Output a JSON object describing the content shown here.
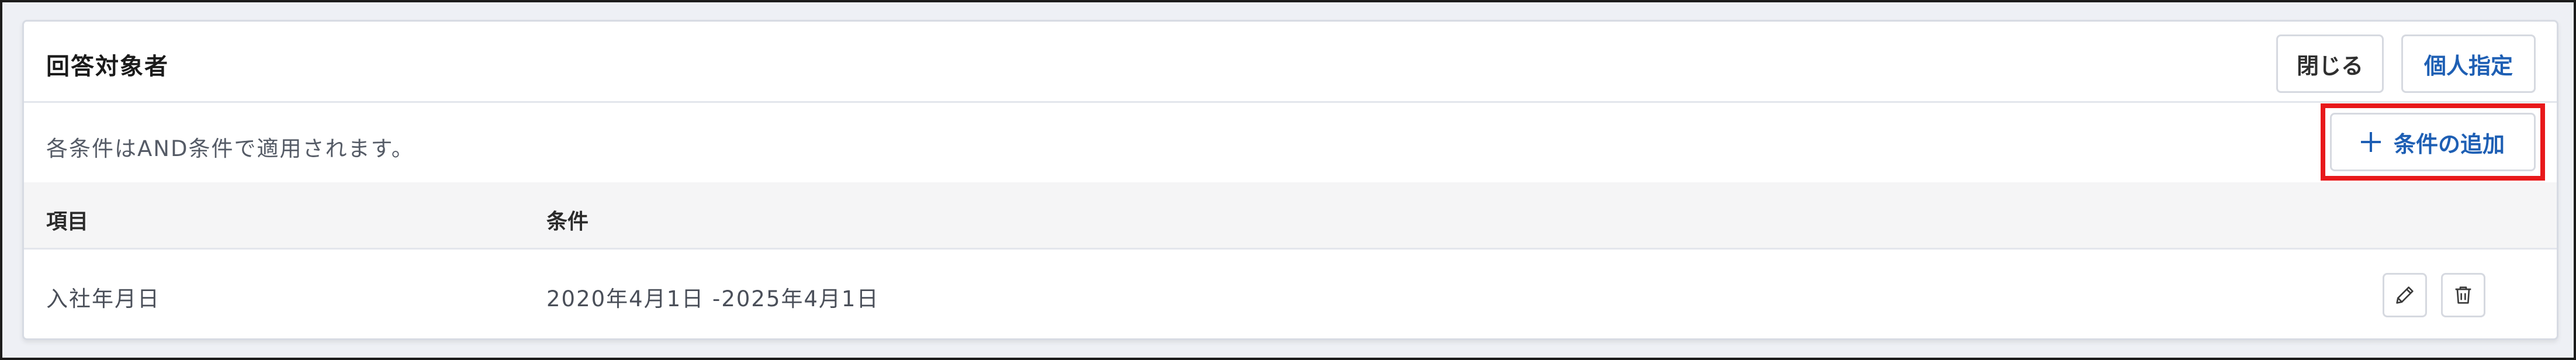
{
  "panel": {
    "title": "回答対象者",
    "close_label": "閉じる",
    "individual_label": "個人指定"
  },
  "conditions": {
    "description": "各条件はAND条件で適用されます。",
    "add_label": "条件の追加"
  },
  "table": {
    "headers": [
      "項目",
      "条件"
    ],
    "rows": [
      {
        "item": "入社年月日",
        "condition": "2020年4月1日 -2025年4月1日",
        "actions": [
          "pencil-icon",
          "trash-icon"
        ]
      }
    ]
  },
  "colors": {
    "accent": "#1e5fb4",
    "highlight": "#e8191b",
    "border": "#d6d9e0",
    "header_bg": "#f5f5f6"
  }
}
